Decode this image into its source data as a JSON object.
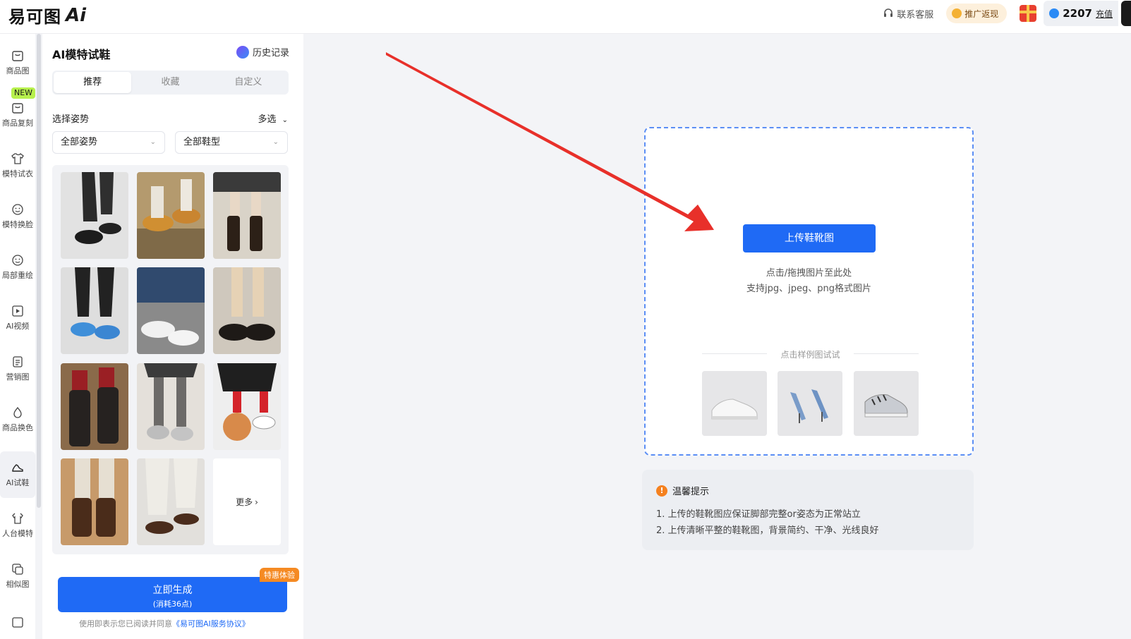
{
  "topbar": {
    "logo_text": "易可图",
    "logo_ai": "Ai",
    "support_label": "联系客服",
    "promo_label": "推广返现",
    "points_value": "2207",
    "recharge_label": "充值"
  },
  "leftnav": {
    "new_badge": "NEW",
    "items": [
      {
        "label": "商品图",
        "icon": "bag-icon"
      },
      {
        "label": "商品复刻",
        "icon": "copy-bag-icon"
      },
      {
        "label": "模特试衣",
        "icon": "shirt-icon"
      },
      {
        "label": "模特换脸",
        "icon": "face-icon"
      },
      {
        "label": "局部重绘",
        "icon": "face-icon"
      },
      {
        "label": "AI视频",
        "icon": "video-icon"
      },
      {
        "label": "营销图",
        "icon": "poster-icon"
      },
      {
        "label": "商品换色",
        "icon": "drop-icon"
      },
      {
        "label": "AI试鞋",
        "icon": "shoe-icon"
      },
      {
        "label": "人台模特",
        "icon": "mannequin-icon"
      },
      {
        "label": "相似图",
        "icon": "similar-icon"
      }
    ]
  },
  "panel": {
    "title": "AI模特试鞋",
    "history_label": "历史记录",
    "tabs": [
      "推荐",
      "收藏",
      "自定义"
    ],
    "pose_label": "选择姿势",
    "multi_label": "多选",
    "select_pose": "全部姿势",
    "select_shoe": "全部鞋型",
    "more_label": "更多",
    "generate_label": "立即生成",
    "generate_cost": "(消耗36点)",
    "special_badge": "特惠体验",
    "agree_prefix": "使用即表示您已阅读并同意",
    "agree_link": "《易可图AI服务协议》"
  },
  "upload": {
    "button_label": "上传鞋靴图",
    "hint1": "点击/拖拽图片至此处",
    "hint2": "支持jpg、jpeg、png格式图片",
    "samples_label": "点击样例图试试"
  },
  "tips": {
    "title": "温馨提示",
    "lines": [
      "1. 上传的鞋靴图应保证脚部完整or姿态为正常站立",
      "2. 上传清晰平整的鞋靴图，背景简约、干净、光线良好"
    ]
  },
  "colors": {
    "primary": "#1f6af5",
    "accent_orange": "#f58a23",
    "new_badge": "#b7f04d",
    "arrow_red": "#e8302a"
  }
}
